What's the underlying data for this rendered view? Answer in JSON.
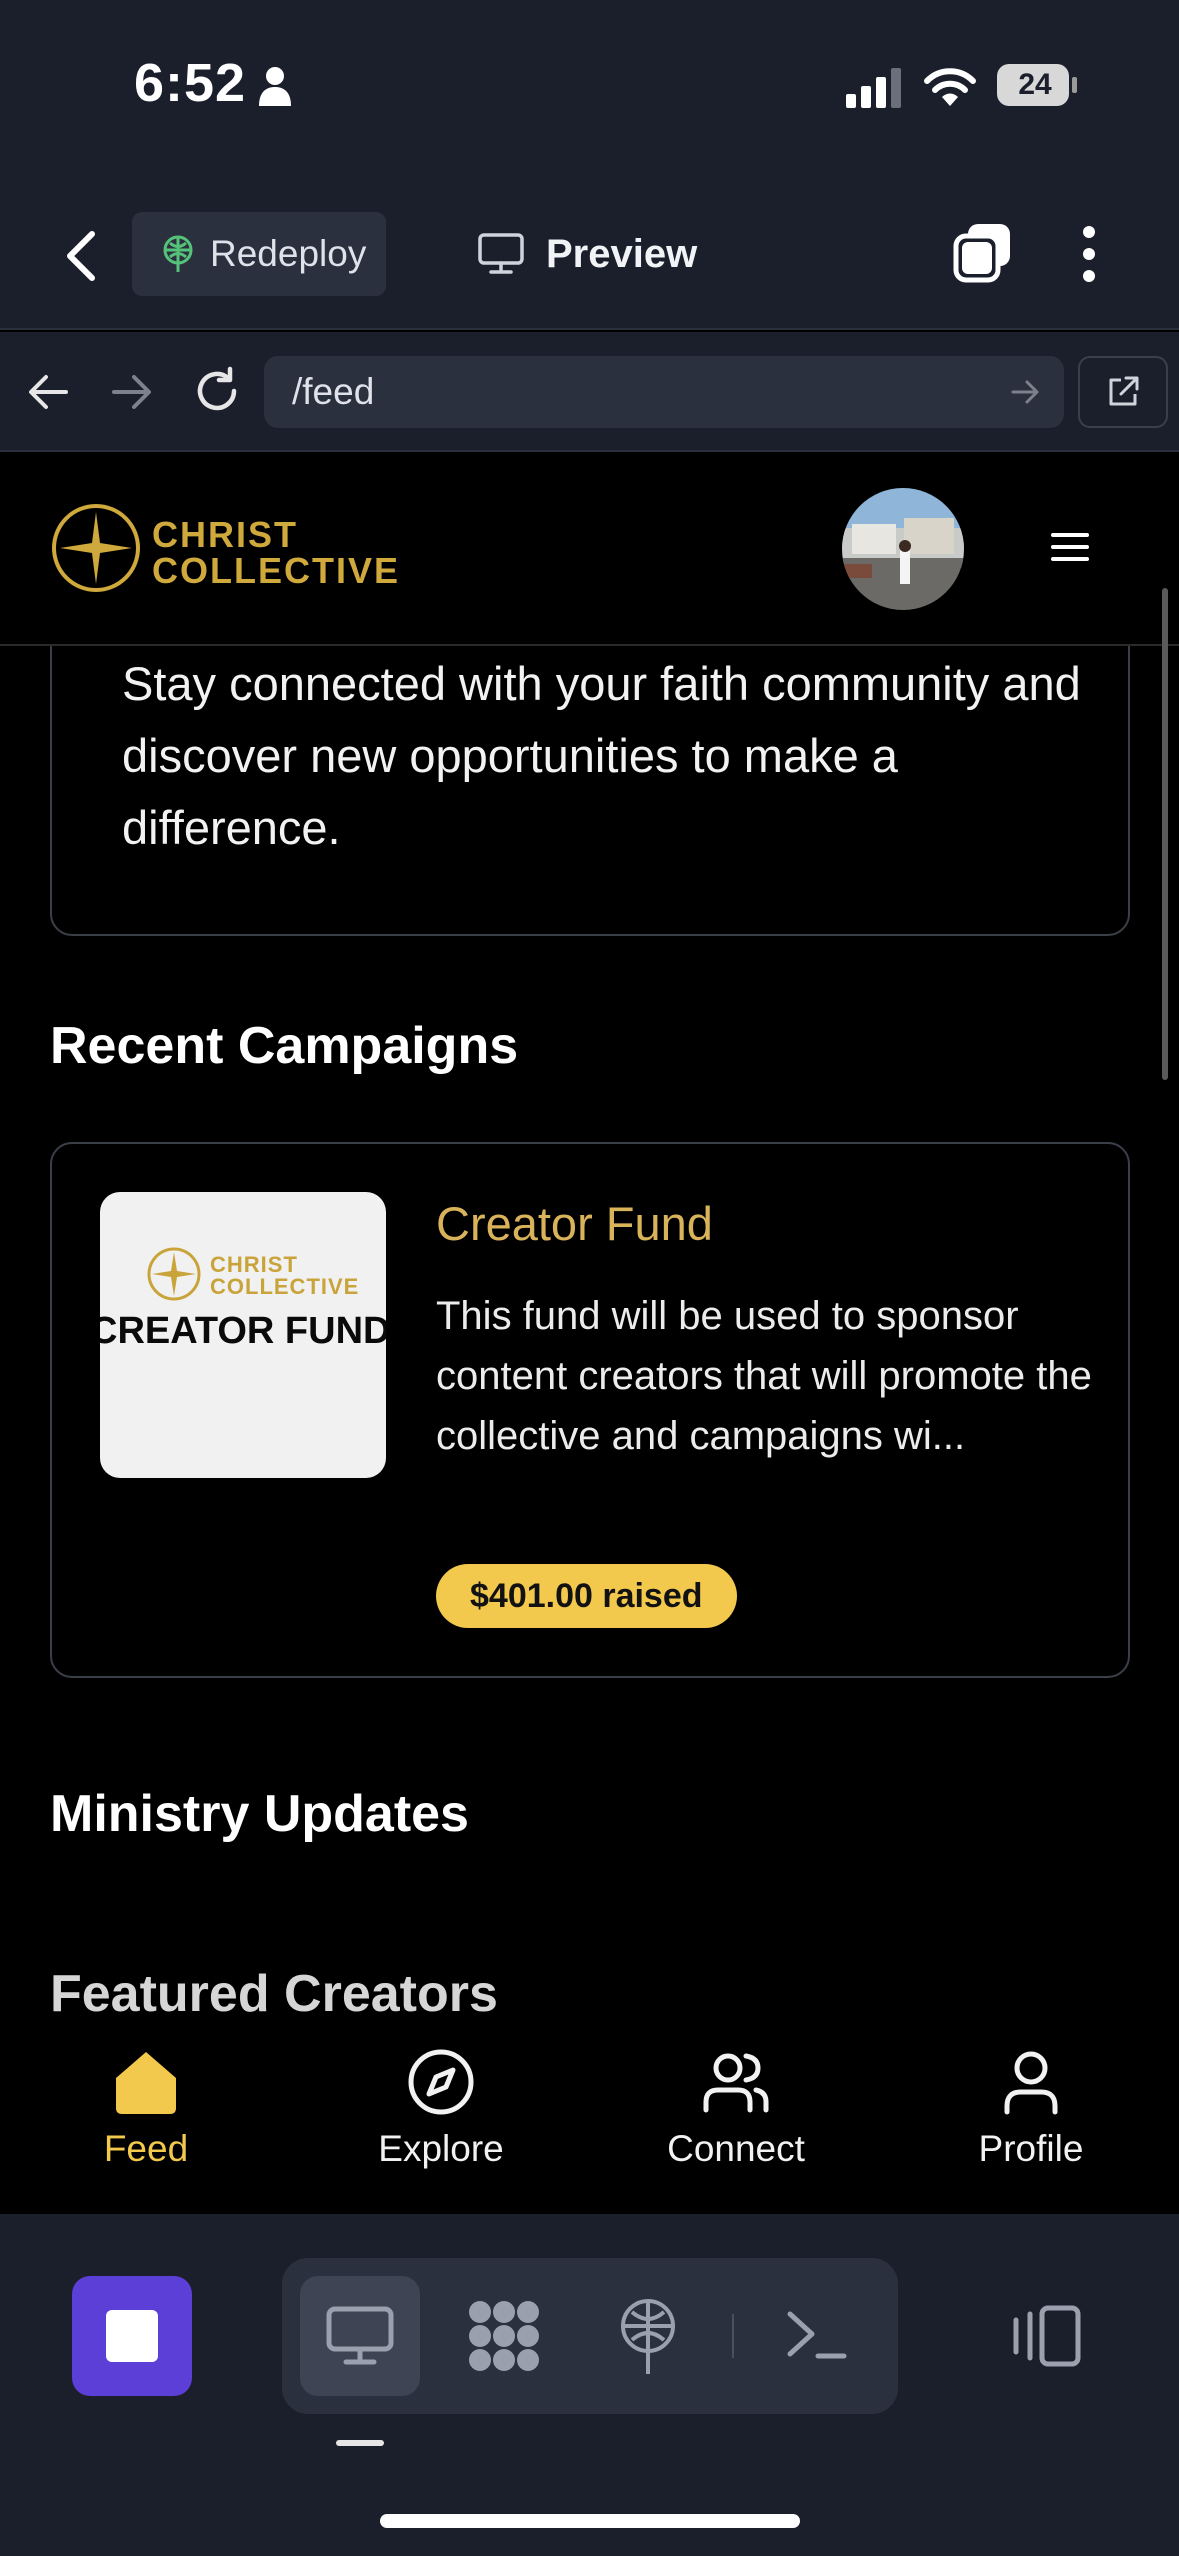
{
  "status_bar": {
    "time": "6:52",
    "battery": "24"
  },
  "app_bar": {
    "redeploy_label": "Redeploy",
    "preview_label": "Preview"
  },
  "url_bar": {
    "url": "/feed"
  },
  "site": {
    "logo_line1": "CHRIST",
    "logo_line2": "COLLECTIVE"
  },
  "welcome": {
    "text": "Stay connected with your faith community and discover new opportunities to make a difference."
  },
  "sections": {
    "recent_campaigns": "Recent Campaigns",
    "ministry_updates": "Ministry Updates",
    "featured_creators": "Featured Creators"
  },
  "campaign": {
    "thumb_logo_line1": "CHRIST",
    "thumb_logo_line2": "COLLECTIVE",
    "thumb_title": "CREATOR FUND",
    "title": "Creator Fund",
    "description": "This fund will be used to sponsor content creators that will promote the collective and campaigns wi...",
    "raised": "$401.00 raised"
  },
  "bottom_nav": [
    {
      "label": "Feed",
      "icon": "home-icon",
      "active": true
    },
    {
      "label": "Explore",
      "icon": "compass-icon",
      "active": false
    },
    {
      "label": "Connect",
      "icon": "users-icon",
      "active": false
    },
    {
      "label": "Profile",
      "icon": "user-icon",
      "active": false
    }
  ],
  "colors": {
    "accent_gold": "#cfa93c",
    "badge_yellow": "#f2c94c",
    "chrome_bg": "#1b1f2c",
    "stop_purple": "#5b3fd6"
  }
}
